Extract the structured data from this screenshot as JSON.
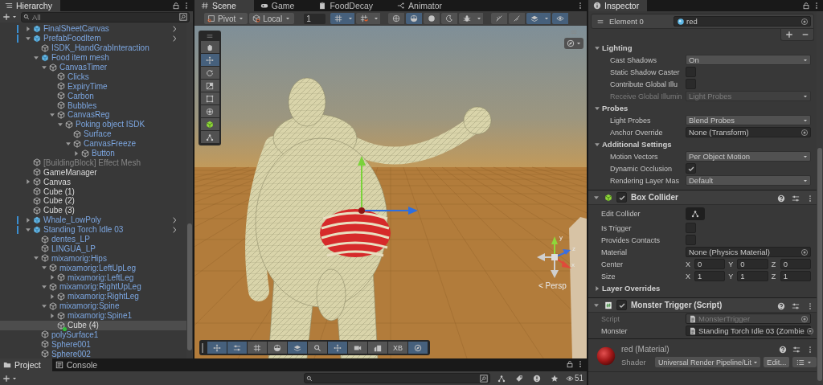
{
  "hierarchy": {
    "title": "Hierarchy",
    "search": {
      "placeholder": "All"
    },
    "items": [
      {
        "label": "FinalSheetCanvas",
        "kind": "prefab-root",
        "expanded": false,
        "selected": false
      },
      {
        "label": "PrefabFoodItem",
        "kind": "prefab-root",
        "expanded": true,
        "selected": false,
        "children": [
          {
            "label": "ISDK_HandGrabInteraction",
            "kind": "prefab",
            "selected": false
          },
          {
            "label": "Food item mesh",
            "kind": "prefab-root",
            "expanded": true,
            "selected": false,
            "children": [
              {
                "label": "CanvasTimer",
                "kind": "prefab",
                "expanded": true,
                "selected": false,
                "children": [
                  {
                    "label": "Clicks",
                    "kind": "prefab",
                    "selected": false
                  },
                  {
                    "label": "ExpiryTime",
                    "kind": "prefab",
                    "selected": false
                  },
                  {
                    "label": "Carbon",
                    "kind": "prefab",
                    "selected": false
                  },
                  {
                    "label": "Bubbles",
                    "kind": "prefab",
                    "selected": false
                  },
                  {
                    "label": "CanvasReg",
                    "kind": "prefab",
                    "expanded": true,
                    "selected": false,
                    "children": [
                      {
                        "label": "Poking object ISDK",
                        "kind": "prefab",
                        "expanded": true,
                        "selected": false,
                        "children": [
                          {
                            "label": "Surface",
                            "kind": "prefab",
                            "selected": false
                          },
                          {
                            "label": "CanvasFreeze",
                            "kind": "prefab",
                            "expanded": true,
                            "selected": false,
                            "children": [
                              {
                                "label": "Button",
                                "kind": "prefab",
                                "expanded": false,
                                "selected": false
                              }
                            ]
                          }
                        ]
                      }
                    ]
                  }
                ]
              }
            ]
          }
        ]
      },
      {
        "label": "[BuildingBlock] Effect Mesh",
        "kind": "inactive",
        "selected": false
      },
      {
        "label": "GameManager",
        "kind": "object",
        "selected": false
      },
      {
        "label": "Canvas",
        "kind": "object",
        "expanded": false,
        "selected": false
      },
      {
        "label": "Cube (1)",
        "kind": "object",
        "selected": false
      },
      {
        "label": "Cube (2)",
        "kind": "object",
        "selected": false
      },
      {
        "label": "Cube (3)",
        "kind": "object",
        "selected": false
      },
      {
        "label": "Whale_LowPoly",
        "kind": "prefab-root",
        "expanded": false,
        "selected": false
      },
      {
        "label": "Standing Torch Idle 03",
        "kind": "prefab-root",
        "expanded": true,
        "selected": false,
        "children": [
          {
            "label": "dentes_LP",
            "kind": "prefab",
            "selected": false
          },
          {
            "label": "LINGUA_LP",
            "kind": "prefab",
            "selected": false
          },
          {
            "label": "mixamorig:Hips",
            "kind": "prefab",
            "expanded": true,
            "selected": false,
            "children": [
              {
                "label": "mixamorig:LeftUpLeg",
                "kind": "prefab",
                "expanded": true,
                "selected": false,
                "children": [
                  {
                    "label": "mixamorig:LeftLeg",
                    "kind": "prefab",
                    "expanded": false,
                    "selected": false
                  }
                ]
              },
              {
                "label": "mixamorig:RightUpLeg",
                "kind": "prefab",
                "expanded": true,
                "selected": false,
                "children": [
                  {
                    "label": "mixamorig:RightLeg",
                    "kind": "prefab",
                    "expanded": false,
                    "selected": false
                  }
                ]
              },
              {
                "label": "mixamorig:Spine",
                "kind": "prefab",
                "expanded": true,
                "selected": false,
                "children": [
                  {
                    "label": "mixamorig:Spine1",
                    "kind": "prefab",
                    "expanded": false,
                    "selected": false
                  },
                  {
                    "label": "Cube (4)",
                    "kind": "object",
                    "selected": true,
                    "added": true
                  }
                ]
              }
            ]
          },
          {
            "label": "polySurface1",
            "kind": "prefab",
            "selected": false
          },
          {
            "label": "Sphere001",
            "kind": "prefab",
            "selected": false
          },
          {
            "label": "Sphere002",
            "kind": "prefab",
            "selected": false
          }
        ]
      }
    ]
  },
  "scene": {
    "tabs": [
      {
        "label": "Scene",
        "selected": true
      },
      {
        "label": "Game",
        "selected": false
      },
      {
        "label": "FoodDecay",
        "selected": false
      },
      {
        "label": "Animator",
        "selected": false
      }
    ],
    "pivot": "Pivot",
    "space": "Local",
    "grid_size": "1",
    "toolbar_toggles": [
      {
        "selected": true
      },
      {
        "selected": false
      },
      {
        "selected": false
      },
      {
        "selected": true
      },
      {
        "selected": false
      },
      {
        "selected": false
      },
      {
        "selected": false
      },
      {
        "selected": false
      },
      {
        "selected": false
      },
      {
        "selected": true
      },
      {
        "selected": true
      }
    ],
    "tools": [
      {
        "selected": false
      },
      {
        "selected": true
      },
      {
        "selected": false
      },
      {
        "selected": false
      },
      {
        "selected": false
      },
      {
        "selected": false
      },
      {
        "selected": false
      },
      {
        "selected": false
      }
    ],
    "overlay_buttons": [
      {
        "selected": true
      },
      {
        "selected": true
      },
      {
        "selected": false
      },
      {
        "selected": false
      },
      {
        "selected": true
      },
      {
        "selected": false
      },
      {
        "selected": true
      },
      {
        "selected": false
      },
      {
        "selected": false
      },
      {
        "label": "XB",
        "selected": false
      },
      {
        "selected": true
      }
    ],
    "gizmo": {
      "label": "< Persp",
      "axes": [
        "y",
        "z",
        "x"
      ]
    }
  },
  "project": {
    "tabs": [
      {
        "label": "Project",
        "selected": true
      },
      {
        "label": "Console",
        "selected": false
      }
    ],
    "count": "51"
  },
  "inspector": {
    "title": "Inspector",
    "element": {
      "label": "Element 0",
      "value": "red"
    },
    "items": [
      {
        "kind": "section",
        "label": "Lighting",
        "expanded": true,
        "children": [
          {
            "kind": "dropdown",
            "label": "Cast Shadows",
            "value": "On",
            "disabled": false
          },
          {
            "kind": "checkbox",
            "label": "Static Shadow Caster",
            "checked": false
          },
          {
            "kind": "checkbox",
            "label": "Contribute Global Illu",
            "checked": false
          },
          {
            "kind": "dropdown",
            "label": "Receive Global Illumin",
            "value": "Light Probes",
            "disabled": true
          }
        ]
      },
      {
        "kind": "section",
        "label": "Probes",
        "expanded": true,
        "children": [
          {
            "kind": "dropdown",
            "label": "Light Probes",
            "value": "Blend Probes",
            "disabled": false
          },
          {
            "kind": "object",
            "label": "Anchor Override",
            "value": "None (Transform)",
            "disabled": false
          }
        ]
      },
      {
        "kind": "section",
        "label": "Additional Settings",
        "expanded": true,
        "children": [
          {
            "kind": "dropdown",
            "label": "Motion Vectors",
            "value": "Per Object Motion",
            "disabled": false
          },
          {
            "kind": "checkbox",
            "label": "Dynamic Occlusion",
            "checked": true
          },
          {
            "kind": "dropdown",
            "label": "Rendering Layer Mas",
            "value": "Default",
            "disabled": false
          }
        ]
      },
      {
        "kind": "collider",
        "label": "Box Collider",
        "enabled": true,
        "expanded": true
      },
      {
        "kind": "edit-button",
        "label": "Edit Collider"
      },
      {
        "kind": "checkbox",
        "label": "Is Trigger",
        "checked": false
      },
      {
        "kind": "checkbox",
        "label": "Provides Contacts",
        "checked": false
      },
      {
        "kind": "object",
        "label": "Material",
        "value": "None (Physics Material)",
        "disabled": false
      },
      {
        "kind": "vector",
        "label": "Center",
        "axes": [
          {
            "axis": "X",
            "value": "0"
          },
          {
            "axis": "Y",
            "value": "0"
          },
          {
            "axis": "Z",
            "value": "0"
          }
        ]
      },
      {
        "kind": "vector",
        "label": "Size",
        "axes": [
          {
            "axis": "X",
            "value": "1"
          },
          {
            "axis": "Y",
            "value": "1"
          },
          {
            "axis": "Z",
            "value": "1"
          }
        ]
      },
      {
        "kind": "section",
        "label": "Layer Overrides",
        "expanded": false
      },
      {
        "kind": "script",
        "label": "Monster Trigger (Script)",
        "enabled": true,
        "expanded": true
      },
      {
        "kind": "asset",
        "label": "Script",
        "value": "MonsterTrigger",
        "disabled": true
      },
      {
        "kind": "asset",
        "label": "Monster",
        "value": "Standing Torch Idle 03 (Zombie",
        "disabled": false
      }
    ],
    "material": {
      "name": "red (Material)",
      "shader_label": "Shader",
      "shader": "Universal Render Pipeline/Lit",
      "edit": "Edit..."
    }
  }
}
